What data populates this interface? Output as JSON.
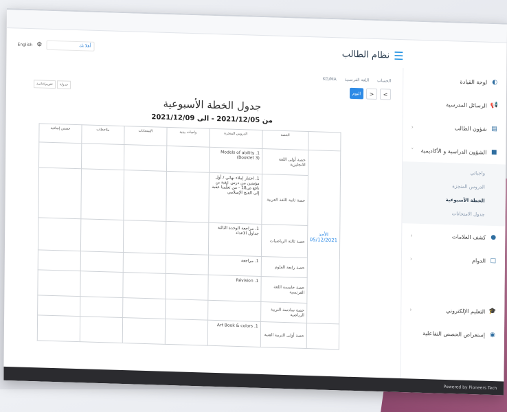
{
  "header": {
    "app_title": "نظام الطالب",
    "language": "English",
    "search_placeholder": "أهلا بك"
  },
  "sidebar": {
    "items": [
      {
        "label": "لوحة القيادة",
        "icon": "dashboard-icon",
        "glyph": "◐"
      },
      {
        "label": "الرسائل المدرسية",
        "icon": "megaphone-icon",
        "glyph": "📢"
      },
      {
        "label": "شؤون الطالب",
        "icon": "book-icon",
        "glyph": "▤"
      },
      {
        "label": "الشؤون الدراسية و الأكاديمية",
        "icon": "briefcase-icon",
        "glyph": "■"
      }
    ],
    "sub_items": [
      "واجباتي",
      "الدروس المنجزة",
      "الخطة الأسبوعية",
      "جدول الامتحانات"
    ],
    "items_after": [
      {
        "label": "كشف العلامات",
        "icon": "dot-icon",
        "glyph": "●"
      },
      {
        "label": "الدوام",
        "icon": "calendar-icon",
        "glyph": "□"
      },
      {
        "label": "التعليم الإلكتروني",
        "icon": "graduation-icon",
        "glyph": "🎓"
      },
      {
        "label": "إستعراض الحصص التفاعلية",
        "icon": "eye-icon",
        "glyph": "◉"
      }
    ]
  },
  "breadcrumb": [
    "الحساب",
    "اللغة الفرنسية",
    "KG/MA"
  ],
  "toolbar": {
    "today": "اليوم",
    "prev": "<",
    "next": ">",
    "view1": "جدولة",
    "view2": "تقويم/قائمة"
  },
  "plan": {
    "title": "جدول الخطة الأسبوعية",
    "range": "من 2021/12/05 - الى 2021/12/09",
    "columns": [
      "الحصة",
      "الدروس المنجزة",
      "واجبات بيتية",
      "الإمتحانات",
      "ملاحظات",
      "حصص إضافية"
    ],
    "day": "الأحد 05/12/2021",
    "rows": [
      {
        "period": "حصة أولى اللغة الانجليزية",
        "lesson": "1. Models of ability (Booklet 3)"
      },
      {
        "period": "حصة ثانية اللغة العربية",
        "lesson": "1. اختبار إملاء نهائي / أول مؤمنين من درس عقبة بن نافع ص18 - من تعلّمنا عقبة إلى الفتح الإسلامي"
      },
      {
        "period": "حصة ثالثة الرياضيات",
        "lesson": "1. مراجعة الوحدة الثالثة جداول الاعداد"
      },
      {
        "period": "حصة رابعة العلوم",
        "lesson": "1. مراجعة"
      },
      {
        "period": "حصة خامسة اللغة الفرنسية",
        "lesson": "1. Révision"
      },
      {
        "period": "حصة سادسة التربية الرياضية",
        "lesson": ""
      },
      {
        "period": "حصة أولى التربية الفنية",
        "lesson": "1. Art Book & colors"
      }
    ]
  },
  "footer": {
    "powered": "Powered by Pioneers Tech"
  }
}
